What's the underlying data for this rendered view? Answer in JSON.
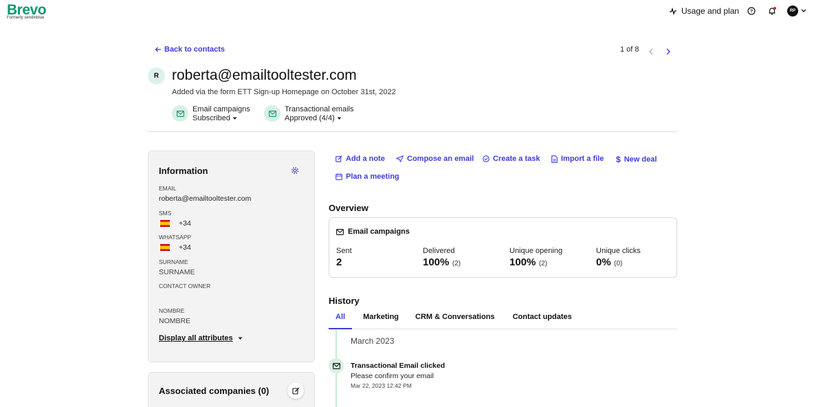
{
  "brand": {
    "name": "Brevo",
    "formerly": "Formerly sendinblue",
    "color": "#0b996e"
  },
  "topnav": {
    "usage_label": "Usage and plan",
    "avatar_initials": "RP"
  },
  "navigation": {
    "back_label": "Back to contacts",
    "pager": "1 of 8"
  },
  "contact": {
    "initial": "R",
    "email": "roberta@emailtooltester.com",
    "added_via": "Added via the form ETT Sign-up Homepage on October 31st, 2022",
    "subscriptions": [
      {
        "title": "Email campaigns",
        "status": "Subscribed"
      },
      {
        "title": "Transactional emails",
        "status": "Approved (4/4)"
      }
    ]
  },
  "information": {
    "title": "Information",
    "email_label": "EMAIL",
    "email_value": "roberta@emailtooltester.com",
    "sms_label": "SMS",
    "sms_value": "+34",
    "whatsapp_label": "WHATSAPP",
    "whatsapp_value": "+34",
    "surname_label": "SURNAME",
    "surname_value": "SURNAME",
    "owner_label": "CONTACT OWNER",
    "nombre_label": "NOMBRE",
    "nombre_value": "NOMBRE",
    "display_all": "Display all attributes"
  },
  "associated": {
    "title": "Associated companies (0)"
  },
  "actions": {
    "add_note": "Add a note",
    "compose": "Compose an email",
    "create_task": "Create a task",
    "import_file": "Import a file",
    "new_deal": "New deal",
    "plan_meeting": "Plan a meeting"
  },
  "overview": {
    "title": "Overview",
    "card_title": "Email campaigns",
    "stats": [
      {
        "label": "Sent",
        "value": "2",
        "sub": ""
      },
      {
        "label": "Delivered",
        "value": "100%",
        "sub": "(2)"
      },
      {
        "label": "Unique opening",
        "value": "100%",
        "sub": "(2)"
      },
      {
        "label": "Unique clicks",
        "value": "0%",
        "sub": "(0)"
      }
    ]
  },
  "history": {
    "title": "History",
    "tabs": [
      "All",
      "Marketing",
      "CRM & Conversations",
      "Contact updates"
    ],
    "month": "March 2023",
    "event": {
      "title": "Transactional Email clicked",
      "body": "Please confirm your email",
      "time": "Mar 22, 2023 12:42 PM"
    }
  },
  "colors": {
    "accent": "#3d3dd8",
    "green": "#0b996e"
  }
}
